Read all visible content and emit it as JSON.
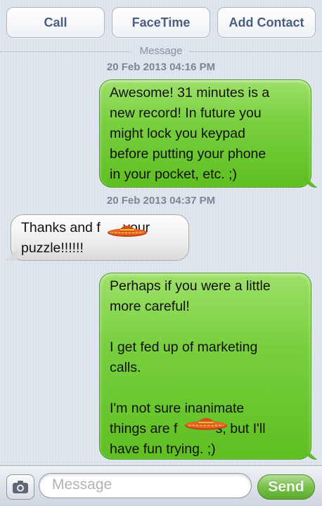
{
  "header": {
    "buttons": [
      {
        "label": "Call"
      },
      {
        "label": "FaceTime"
      },
      {
        "label": "Add Contact"
      }
    ]
  },
  "thread": {
    "divider_label": "Message",
    "timestamps": [
      "20 Feb 2013 04:16 PM",
      "20 Feb 2013 04:37 PM"
    ],
    "messages": [
      {
        "direction": "outgoing",
        "lines": [
          "Awesome! 31 minutes is a",
          "new record! In future you",
          "might lock you keypad",
          "before putting your phone",
          "in your pocket, etc. ;)"
        ]
      },
      {
        "direction": "incoming",
        "lines": [
          "Thanks and f      your",
          "puzzle!!!!!!"
        ]
      },
      {
        "direction": "outgoing",
        "lines": [
          "Perhaps if you were a little",
          "more careful!",
          "",
          "I get fed up of marketing",
          "calls.",
          "",
          "I'm not sure inanimate",
          "things are f          s, but I'll",
          "have fun trying. ;)"
        ]
      }
    ]
  },
  "compose": {
    "placeholder": "Message",
    "send_label": "Send"
  },
  "colors": {
    "outgoing_bubble": "#78cf3e",
    "incoming_bubble": "#ececec",
    "button_text": "#4a5e82",
    "send_button": "#79c14b"
  },
  "icons": {
    "camera": "camera-icon",
    "censor": "sombrero-censor-icon"
  }
}
